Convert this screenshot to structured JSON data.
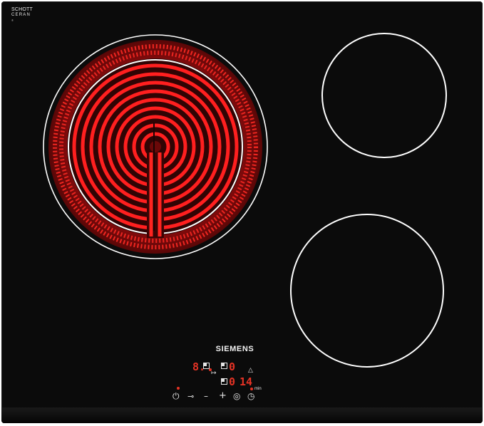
{
  "logo": {
    "line1": "SCHOTT",
    "line2": "CERAN",
    "line3": "®"
  },
  "brand": {
    "name": "SIEMENS"
  },
  "display": {
    "zone_level": "8.",
    "level_2": "0",
    "timer_left": "0",
    "timer_right": "14",
    "timer_unit": "min"
  },
  "icons": {
    "power": "⏻",
    "key": "⊸",
    "minus": "–",
    "plus": "+",
    "target": "◎",
    "clock": "◷",
    "bell": "△",
    "hold": "↦"
  },
  "colors": {
    "glass": "#0b0b0b",
    "glow": "#e8161c",
    "display_red": "#e63325",
    "marking": "#ffffff"
  }
}
